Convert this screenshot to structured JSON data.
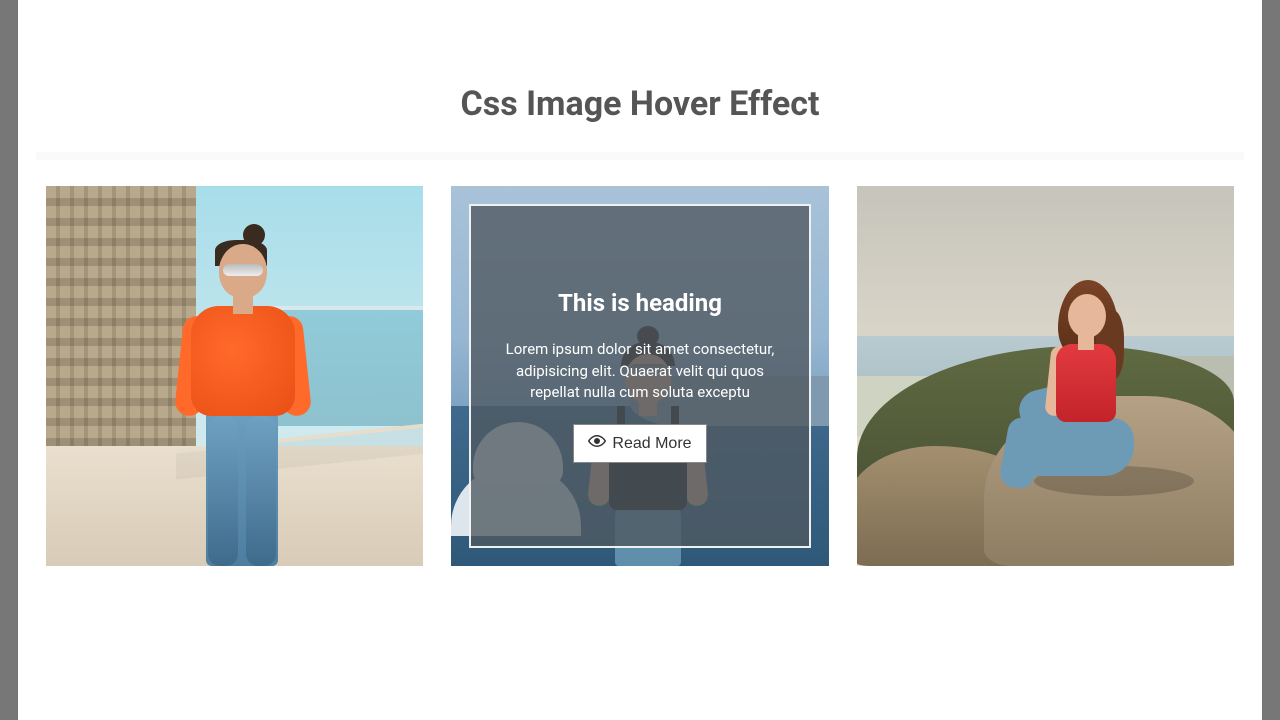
{
  "page": {
    "title": "Css Image Hover Effect"
  },
  "cards": [
    {
      "alt": "Woman in orange shirt standing on rooftop with city buildings"
    },
    {
      "alt": "Woman in black crop top looking up with sea and domes behind",
      "overlay": {
        "heading": "This is heading",
        "body": "Lorem ipsum dolor sit amet consectetur, adipisicing elit. Quaerat velit qui quos repellat nulla cum soluta exceptu",
        "button_label": "Read More"
      }
    },
    {
      "alt": "Woman in red top sitting on coastal rocks at sunset"
    }
  ]
}
